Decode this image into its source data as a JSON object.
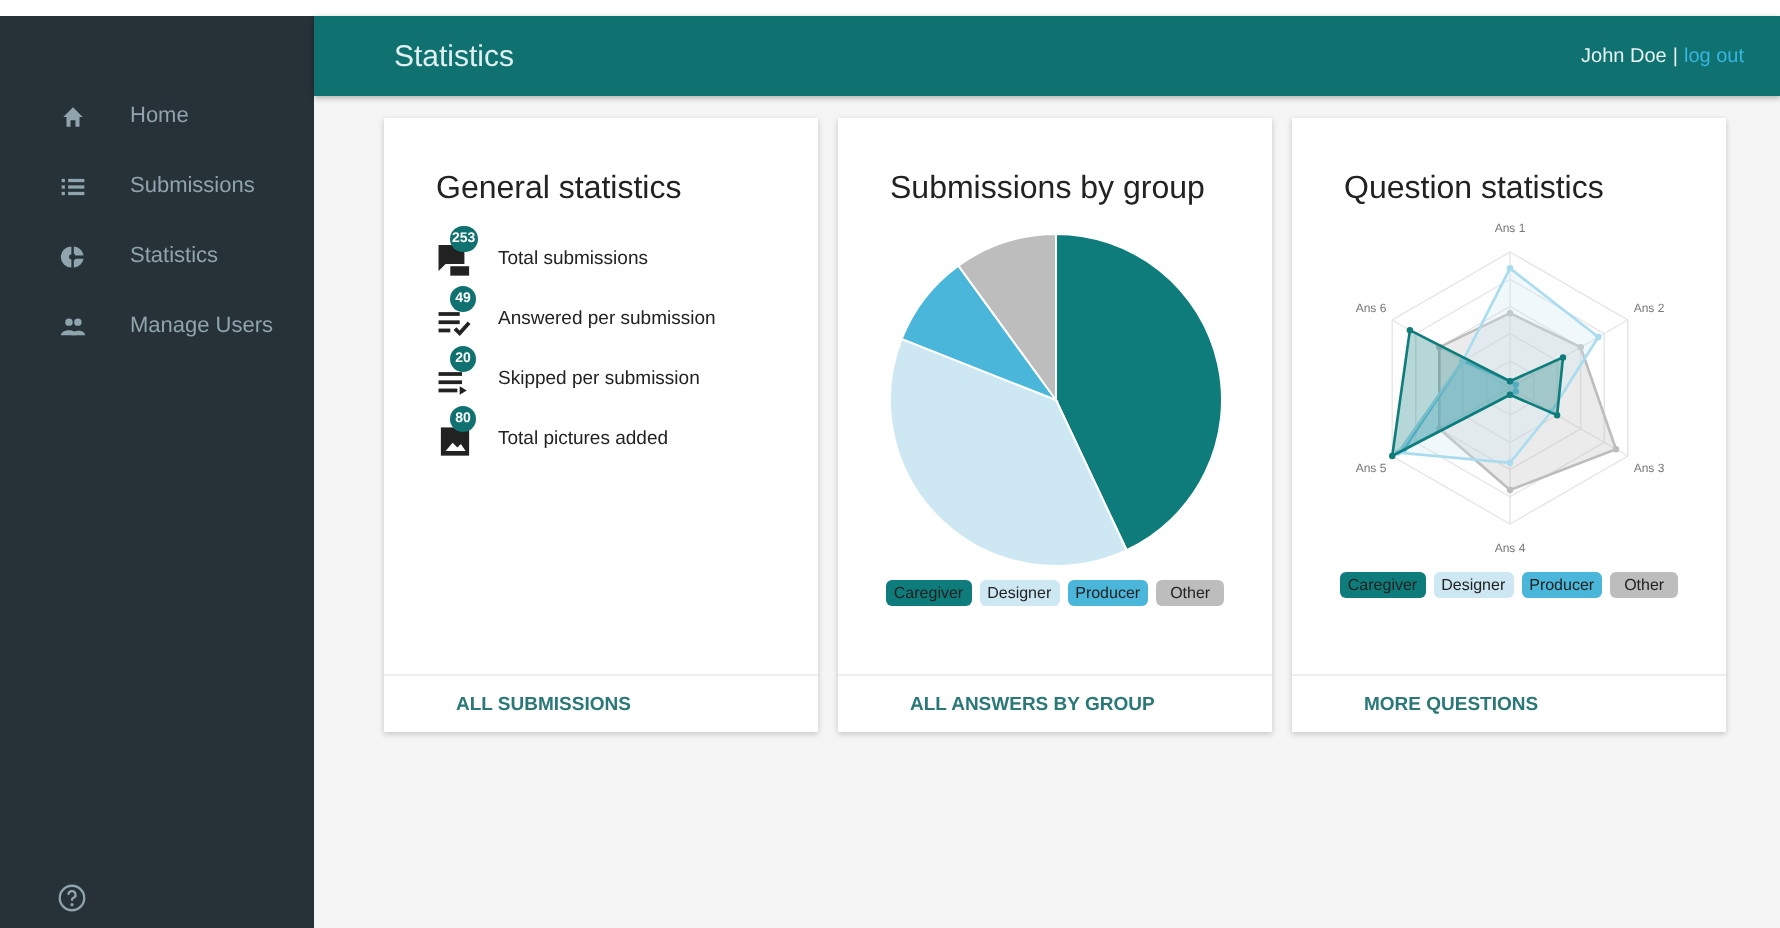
{
  "header": {
    "title": "Statistics",
    "user": "John Doe",
    "separator": "|",
    "logout": "log out"
  },
  "sidebar": {
    "items": [
      {
        "label": "Home"
      },
      {
        "label": "Submissions"
      },
      {
        "label": "Statistics"
      },
      {
        "label": "Manage Users"
      }
    ]
  },
  "cards": [
    {
      "kind": "stats",
      "title": "General statistics",
      "items": [
        {
          "count": "253",
          "label": "Total submissions"
        },
        {
          "count": "49",
          "label": "Answered per submission"
        },
        {
          "count": "20",
          "label": "Skipped per submission"
        },
        {
          "count": "80",
          "label": "Total pictures added"
        }
      ],
      "action": "ALL SUBMISSIONS"
    },
    {
      "kind": "pie",
      "title": "Submissions by group",
      "legend": [
        {
          "label": "Caregiver",
          "color": "#0e7c7b"
        },
        {
          "label": "Designer",
          "color": "#cde8f3"
        },
        {
          "label": "Producer",
          "color": "#4ab6d9"
        },
        {
          "label": "Other",
          "color": "#bdbdbd"
        }
      ],
      "action": "ALL ANSWERS BY GROUP"
    },
    {
      "kind": "radar",
      "title": "Question statistics",
      "axes": [
        "Ans 1",
        "Ans 2",
        "Ans 3",
        "Ans 4",
        "Ans 5",
        "Ans 6"
      ],
      "legend": [
        {
          "label": "Caregiver",
          "color": "#0e7c7b"
        },
        {
          "label": "Designer",
          "color": "#cde8f3"
        },
        {
          "label": "Producer",
          "color": "#4ab6d9"
        },
        {
          "label": "Other",
          "color": "#bdbdbd"
        }
      ],
      "action": "MORE QUESTIONS"
    }
  ]
}
